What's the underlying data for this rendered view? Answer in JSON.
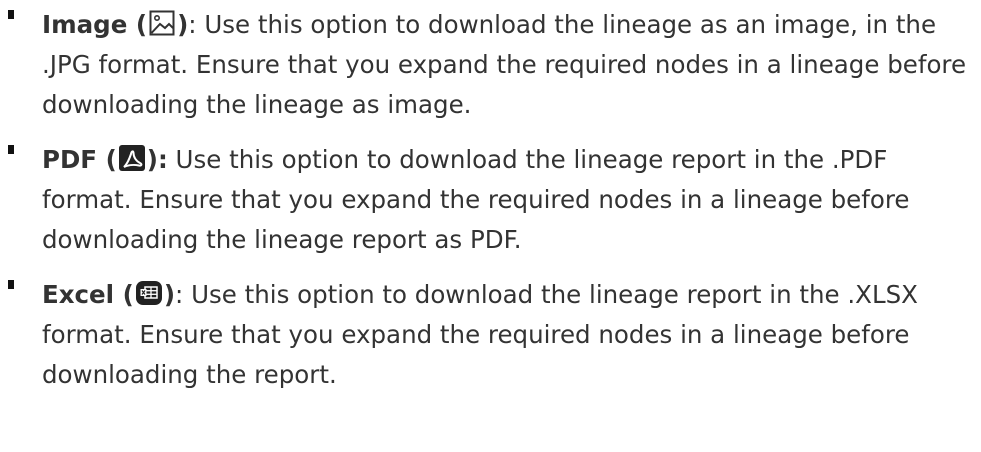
{
  "items": [
    {
      "label": "Image",
      "open": "(",
      "close": ")",
      "icon": "image-icon",
      "colon": ":",
      "text": " Use this option to download the lineage as an image, in the .JPG format. Ensure that you expand the required nodes in a lineage before downloading the lineage as image."
    },
    {
      "label": "PDF",
      "open": "(",
      "close": "):",
      "icon": "pdf-icon",
      "colon": "",
      "text": " Use this option to download the lineage report in the .PDF format. Ensure that you expand the required nodes in a lineage before downloading the lineage report as PDF."
    },
    {
      "label": "Excel",
      "open": "(",
      "close": ")",
      "icon": "excel-icon",
      "colon": ":",
      "text": " Use this option to download the lineage report in the .XLSX format. Ensure that you expand the required nodes in a lineage before downloading the report."
    }
  ]
}
